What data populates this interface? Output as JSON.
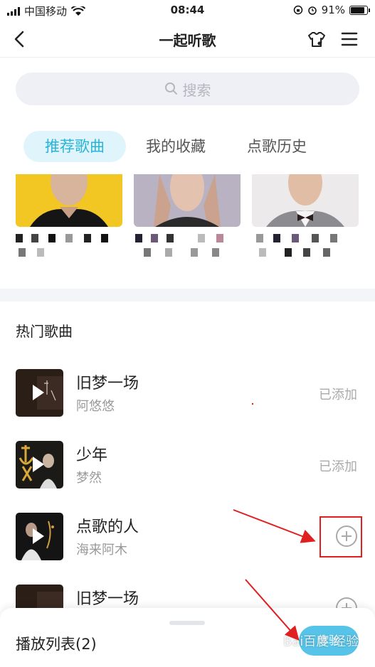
{
  "status_bar": {
    "carrier": "中国移动",
    "time": "08:44",
    "battery": "91%",
    "battery_level": 0.91
  },
  "nav": {
    "title": "一起听歌"
  },
  "search": {
    "placeholder": "搜索"
  },
  "tabs": [
    {
      "label": "推荐歌曲",
      "active": true
    },
    {
      "label": "我的收藏",
      "active": false
    },
    {
      "label": "点歌历史",
      "active": false
    }
  ],
  "hot": {
    "title": "热门歌曲",
    "songs": [
      {
        "name": "旧梦一场",
        "artist": "阿悠悠",
        "status": "已添加"
      },
      {
        "name": "少年",
        "artist": "梦然",
        "status": "已添加"
      },
      {
        "name": "点歌的人",
        "artist": "海来阿木",
        "status": ""
      },
      {
        "name": "旧梦一场",
        "artist": "",
        "status": ""
      }
    ]
  },
  "playlist": {
    "label": "播放列表(2)",
    "button": "体验"
  },
  "watermark": "Bai百度 经验",
  "colors": {
    "accent": "#28b3d8",
    "tab_active_bg": "#e0f5fb",
    "annotation": "#e02020"
  }
}
